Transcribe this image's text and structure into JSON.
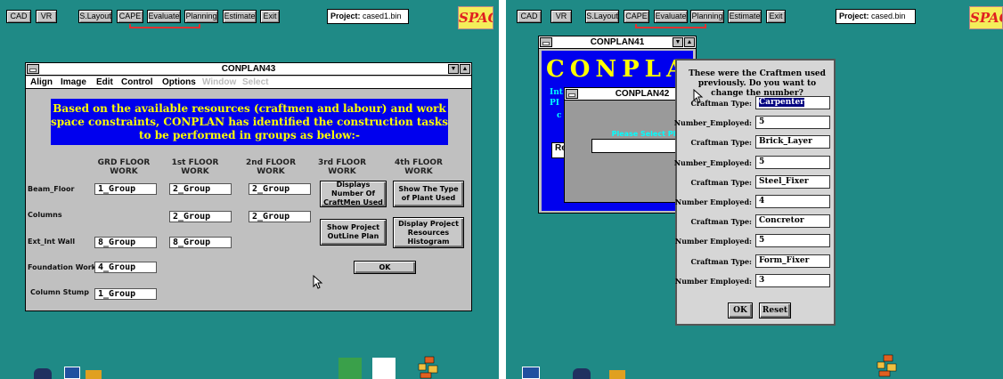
{
  "toolbar": {
    "buttons": [
      "CAD",
      "VR",
      "S.Layout",
      "CAPE",
      "Evaluate",
      "Planning",
      "Estimate",
      "Exit"
    ],
    "active": "Planning"
  },
  "left": {
    "project_label": "Project:",
    "project_value": "cased1.bin",
    "logo_text": "SPACE",
    "window": {
      "title": "CONPLAN43",
      "menu": [
        "Align",
        "Image",
        "Edit",
        "Control",
        "Options",
        "Window",
        "Select"
      ],
      "banner": "Based on the available resources (craftmen and labour) and work space constraints, CONPLAN has identified the construction tasks to be performed in groups as below:-",
      "columns": [
        "GRD FLOOR WORK",
        "1st FLOOR WORK",
        "2nd FLOOR WORK",
        "3rd FLOOR WORK",
        "4th FLOOR WORK"
      ],
      "rows": [
        "Beam_Floor",
        "Columns",
        "Ext_Int Wall",
        "Foundation Work",
        "Column Stump"
      ],
      "cells": {
        "beam_grd": "1_Group",
        "beam_1st": "2_Group",
        "beam_2nd": "2_Group",
        "col_1st": "2_Group",
        "col_2nd": "2_Group",
        "wall_grd": "8_Group",
        "wall_1st": "8_Group",
        "found_grd": "4_Group",
        "stump_grd": "1_Group"
      },
      "buttons": {
        "craftmen": "Displays Number Of CraftMen Used",
        "plant": "Show The Type of Plant Used",
        "outline": "Show Project OutLine Plan",
        "histogram": "Display Project Resources Histogram",
        "ok": "OK"
      }
    }
  },
  "right": {
    "project_label": "Project:",
    "project_value": "cased.bin",
    "logo_text": "SPACE",
    "win41_title": "CONPLAN41",
    "win41_text": "CONPLA",
    "win41_side": [
      "Int",
      "PI",
      "c",
      "Re"
    ],
    "win42_title": "CONPLAN42",
    "win42_prompt": "Please Select Plan",
    "dialog": {
      "question": "These were the Craftmen used previously. Do you want to change the number?",
      "fields": [
        {
          "label": "Craftman Type:",
          "value": "Carpenter"
        },
        {
          "label": "Number_Employed:",
          "value": "5"
        },
        {
          "label": "Craftman Type:",
          "value": "Brick_Layer"
        },
        {
          "label": "Number_Employed:",
          "value": "5"
        },
        {
          "label": "Craftman Type:",
          "value": "Steel_Fixer"
        },
        {
          "label": "Number Employed:",
          "value": "4"
        },
        {
          "label": "Craftman Type:",
          "value": "Concretor"
        },
        {
          "label": "Number Employed:",
          "value": "5"
        },
        {
          "label": "Craftman Type:",
          "value": "Form_Fixer"
        },
        {
          "label": "Number Employed:",
          "value": "3"
        }
      ],
      "ok": "OK",
      "reset": "Reset"
    }
  },
  "colors": {
    "desktop": "#1f8a86",
    "banner": "#0000ee",
    "banner_text": "#ffff00",
    "highlight": "#e23030"
  }
}
